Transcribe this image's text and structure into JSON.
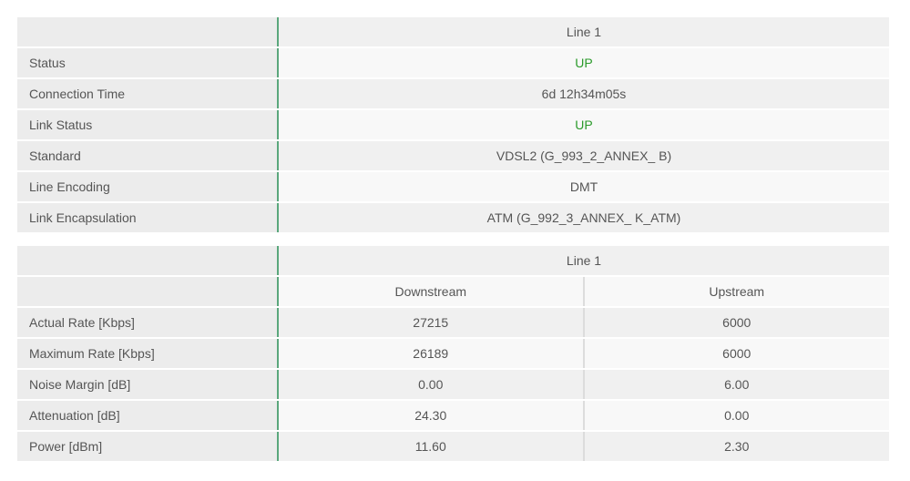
{
  "status_table": {
    "header": "Line 1",
    "rows": [
      {
        "label": "Status",
        "value": "UP",
        "status": "up"
      },
      {
        "label": "Connection Time",
        "value": "6d 12h34m05s"
      },
      {
        "label": "Link Status",
        "value": "UP",
        "status": "up"
      },
      {
        "label": "Standard",
        "value": "VDSL2 (G_993_2_ANNEX_ B)"
      },
      {
        "label": "Line Encoding",
        "value": "DMT"
      },
      {
        "label": "Link Encapsulation",
        "value": "ATM (G_992_3_ANNEX_ K_ATM)"
      }
    ]
  },
  "rate_table": {
    "header": "Line 1",
    "columns": [
      "Downstream",
      "Upstream"
    ],
    "rows": [
      {
        "label": "Actual Rate [Kbps]",
        "downstream": "27215",
        "upstream": "6000"
      },
      {
        "label": "Maximum Rate [Kbps]",
        "downstream": "26189",
        "upstream": "6000"
      },
      {
        "label": "Noise Margin [dB]",
        "downstream": "0.00",
        "upstream": "6.00"
      },
      {
        "label": "Attenuation [dB]",
        "downstream": "24.30",
        "upstream": "0.00"
      },
      {
        "label": "Power [dBm]",
        "downstream": "11.60",
        "upstream": "2.30"
      }
    ]
  },
  "colors": {
    "status_up": "#2a9a2a",
    "label_divider": "#5aa77c"
  }
}
